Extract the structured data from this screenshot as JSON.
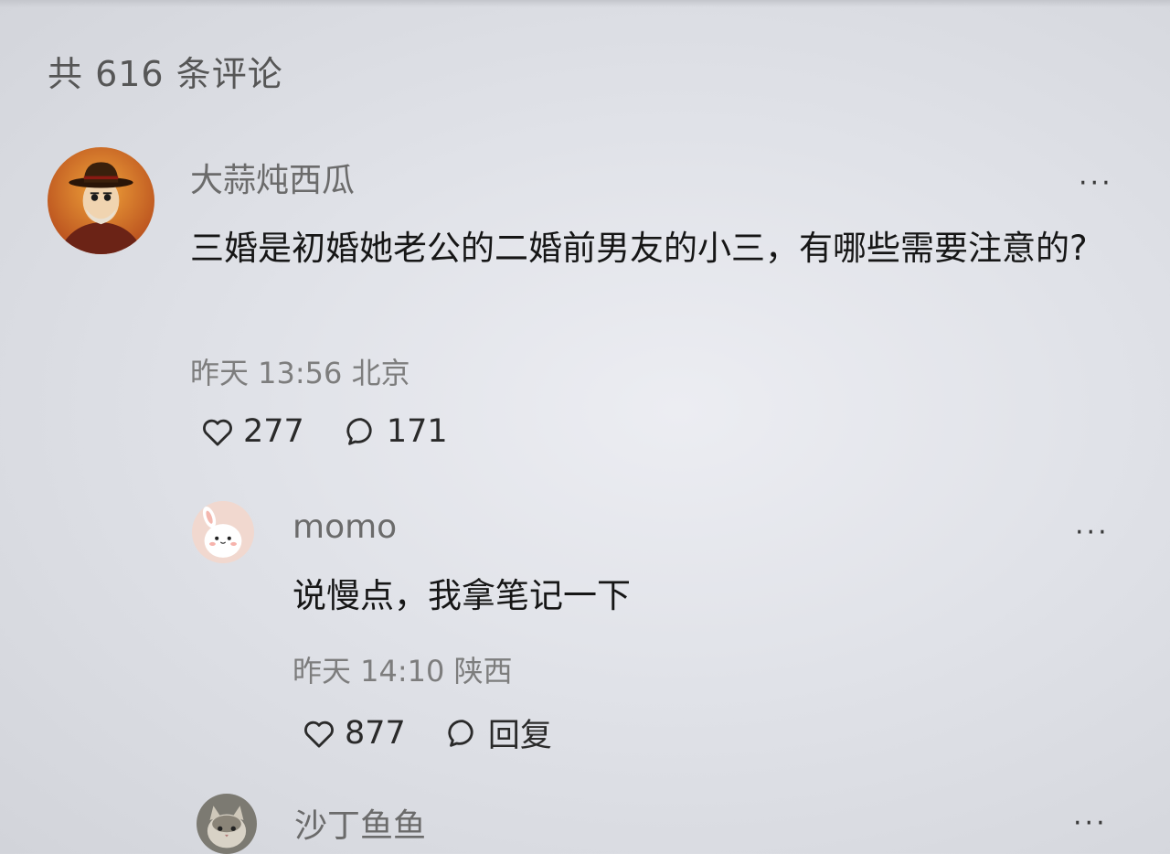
{
  "header": {
    "count_text": "共 616 条评论"
  },
  "comments": [
    {
      "username": "大蒜炖西瓜",
      "content": "三婚是初婚她老公的二婚前男友的小三，有哪些需要注意的?",
      "time": "昨天 13:56",
      "location": "北京",
      "likes": "277",
      "replies": "171",
      "avatar_icon": "cowboy-avatar-icon"
    },
    {
      "username": "momo",
      "content": "说慢点，我拿笔记一下",
      "time": "昨天 14:10",
      "location": "陕西",
      "likes": "877",
      "reply_label": "回复",
      "avatar_icon": "bunny-avatar-icon"
    },
    {
      "username": "沙丁鱼鱼",
      "avatar_icon": "cat-avatar-icon"
    }
  ],
  "ui": {
    "more_glyph": "···"
  },
  "colors": {
    "background": "#e4e6eb",
    "text_primary": "#161616",
    "text_secondary": "#7d7d7d",
    "username": "#6b6b6b"
  }
}
